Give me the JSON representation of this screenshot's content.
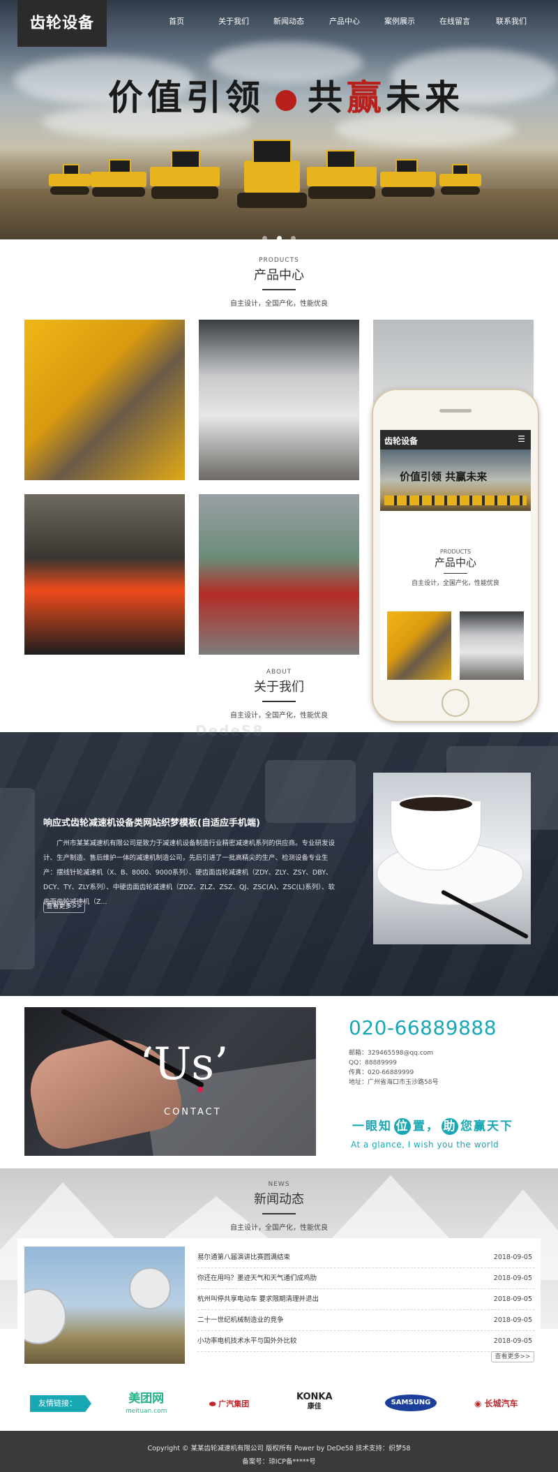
{
  "header": {
    "logo": "齿轮设备",
    "nav": [
      "首页",
      "关于我们",
      "新闻动态",
      "产品中心",
      "案例展示",
      "在线留言",
      "联系我们"
    ]
  },
  "banner": {
    "slogan_part1": "价值引领",
    "slogan_part2": "共",
    "slogan_red": "赢",
    "slogan_part3": "未来",
    "slide_count": 3,
    "active_slide": 2
  },
  "products": {
    "en": "PRODUCTS",
    "title": "产品中心",
    "subtitle": "自主设计，全国产化，性能优良",
    "items": [
      "product-1",
      "product-2",
      "product-3",
      "product-4",
      "product-5"
    ]
  },
  "mobile_preview": {
    "logo": "齿轮设备",
    "menu_icon": "hamburger-icon",
    "slogan": "价值引领 共赢未来",
    "en": "PRODUCTS",
    "title": "产品中心",
    "subtitle": "自主设计，全国产化，性能优良"
  },
  "about_heading": {
    "en": "ABOUT",
    "title": "关于我们",
    "subtitle": "自主设计，全国产化，性能优良"
  },
  "about": {
    "title": "响应式齿轮减速机设备类网站织梦模板(自适应手机端)",
    "body": "广州市某某减速机有限公司是致力于减速机设备制造行业精密减速机系列的供应商。专业研发设计、生产制造、售后维护一体的减速机制造公司，先后引进了一批高精尖的生产、检测设备专业生产：摆线针轮减速机（X、B、8000、9000系列）、硬齿面齿轮减速机（ZDY、ZLY、ZSY、DBY、DCY、TY、ZLY系列）、中硬齿面齿轮减速机（ZDZ、ZLZ、ZSZ、QJ、ZSC(A)、ZSC(L)系列）、软齿面齿轮减速机（Z...",
    "more": "查看更多>>",
    "watermark": "DedeS8"
  },
  "contact": {
    "us": "‘Us’",
    "contact_word": "CONTACT",
    "phone": "020-66889888",
    "email": "邮箱：329465598@qq.com",
    "qq": "QQ：88889999",
    "fax": "传真：020-66889999",
    "address": "地址：广州省海口市玉沙路58号",
    "tagline_1": "一眼知",
    "tagline_c1": "位",
    "tagline_2": "置，",
    "tagline_c2": "助",
    "tagline_3": "您赢天下",
    "tagline_en": "At a glance, I wish you the world"
  },
  "news": {
    "en": "NEWS",
    "title": "新闻动态",
    "subtitle": "自主设计，全国产化，性能优良",
    "items": [
      {
        "title": "易尔通第八届演讲比赛圆满结束",
        "date": "2018-09-05"
      },
      {
        "title": "你还在用吗？墨迹天气和天气通们成鸡肋",
        "date": "2018-09-05"
      },
      {
        "title": "杭州叫停共享电动车 要求限期清理并退出",
        "date": "2018-09-05"
      },
      {
        "title": "二十一世纪机械制造业的竞争",
        "date": "2018-09-05"
      },
      {
        "title": "小功率电机技术水平与国外外比较",
        "date": "2018-09-05"
      }
    ],
    "more": "查看更多>>"
  },
  "links": {
    "label": "友情链接：",
    "partners": {
      "meituan": "美团网",
      "meituan_url": "meituan.com",
      "gac": "广汽集团",
      "konka": "KONKA",
      "konka_cn": "康佳",
      "samsung": "SAMSUNG",
      "greatwall": "长城汽车"
    }
  },
  "footer": {
    "copyright": "Copyright © 某某齿轮减速机有限公司 版权所有 Power by DeDe58 技术支持：织梦58",
    "icp": "备案号：琼ICP备*****号"
  },
  "colors": {
    "accent": "#17a8b4",
    "dark": "#2b2b2b",
    "about_bg": "#2a3140",
    "footer_bg": "#3a3a3a"
  }
}
